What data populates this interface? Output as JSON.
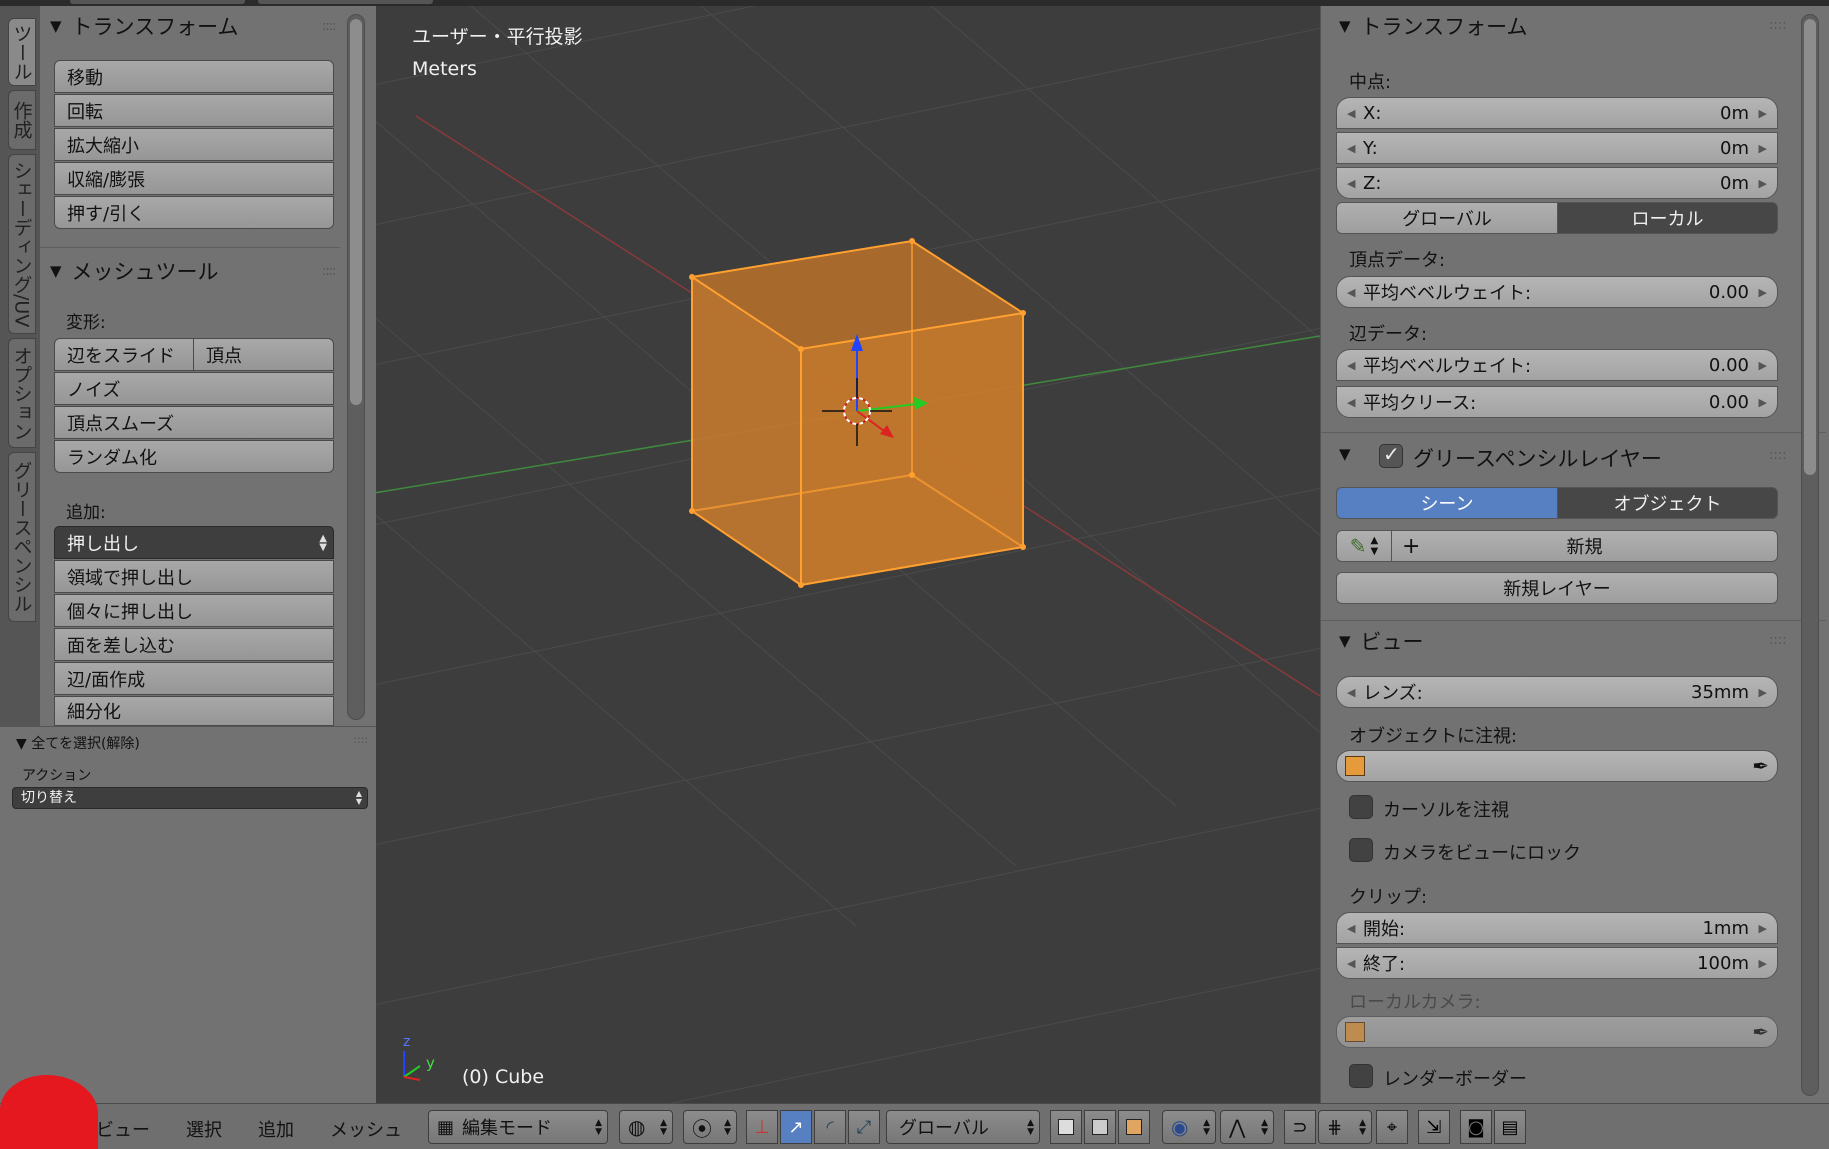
{
  "tabs": [
    "ツール",
    "作成",
    "シェーディング/UV",
    "オプション",
    "グリースペンシル"
  ],
  "toolshelf": {
    "transform": {
      "title": "トランスフォーム",
      "buttons": [
        "移動",
        "回転",
        "拡大縮小",
        "収縮/膨張",
        "押す/引く"
      ]
    },
    "meshtools": {
      "title": "メッシュツール",
      "deform_label": "変形:",
      "slide_edge": "辺をスライド",
      "vertex": "頂点",
      "deform_buttons": [
        "ノイズ",
        "頂点スムーズ",
        "ランダム化"
      ],
      "add_label": "追加:",
      "extrude": "押し出し",
      "add_buttons": [
        "領域で押し出し",
        "個々に押し出し",
        "面を差し込む",
        "辺/面作成",
        "細分化"
      ]
    }
  },
  "operator": {
    "title": "全てを選択(解除)",
    "action_label": "アクション",
    "action_value": "切り替え"
  },
  "viewport": {
    "view_name": "ユーザー・平行投影",
    "units": "Meters",
    "object_info": "(0) Cube",
    "axis_z": "z",
    "axis_y": "y"
  },
  "props": {
    "transform": {
      "title": "トランスフォーム",
      "median": "中点:",
      "x_label": "X:",
      "x_value": "0m",
      "y_label": "Y:",
      "y_value": "0m",
      "z_label": "Z:",
      "z_value": "0m",
      "global": "グローバル",
      "local": "ローカル",
      "vertex_data": "頂点データ:",
      "mean_bevel_v": "平均ベベルウェイト:",
      "mean_bevel_v_value": "0.00",
      "edge_data": "辺データ:",
      "mean_bevel_e": "平均ベベルウェイト:",
      "mean_bevel_e_value": "0.00",
      "mean_crease": "平均クリース:",
      "mean_crease_value": "0.00"
    },
    "gpencil": {
      "title": "グリースペンシルレイヤー",
      "scene": "シーン",
      "object": "オブジェクト",
      "new": "新規",
      "new_layer": "新規レイヤー"
    },
    "view": {
      "title": "ビュー",
      "lens_label": "レンズ:",
      "lens_value": "35mm",
      "lock_object": "オブジェクトに注視:",
      "lock_cursor": "カーソルを注視",
      "lock_camera": "カメラをビューにロック",
      "clip": "クリップ:",
      "clip_start": "開始:",
      "clip_start_value": "1mm",
      "clip_end": "終了:",
      "clip_end_value": "100m",
      "local_camera": "ローカルカメラ:",
      "render_border": "レンダーボーダー"
    }
  },
  "header": {
    "menus": [
      "ビュー",
      "選択",
      "追加",
      "メッシュ"
    ],
    "mode": "編集モード",
    "orientation": "グローバル"
  },
  "colors": {
    "cube_fill": "#c97a2a",
    "cube_edge": "#ffa030",
    "accent_blue": "#5680c2",
    "annotation_red": "#e5171f"
  }
}
